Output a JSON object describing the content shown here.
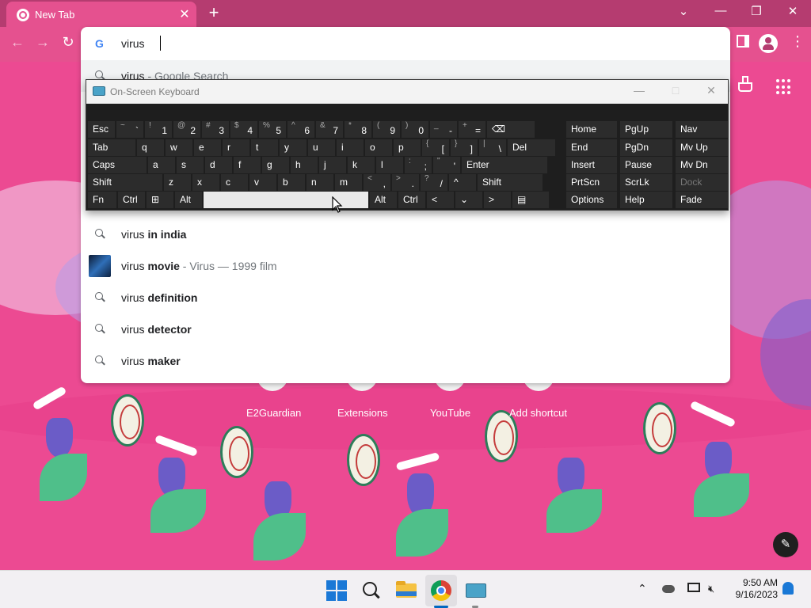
{
  "browser": {
    "tab_title": "New Tab",
    "tab_close": "✕",
    "new_tab": "+",
    "window_controls": {
      "dropdown": "⌄",
      "minimize": "—",
      "restore": "❐",
      "close": "✕"
    },
    "toolbar": {
      "back": "←",
      "forward": "→",
      "reload": "↻",
      "menu": "⋮"
    }
  },
  "omnibox": {
    "query": "virus",
    "suggestions": [
      {
        "prefix": "virus",
        "bold": "",
        "sub": " - Google Search",
        "icon": "search-icon"
      },
      {
        "prefix": "virus ",
        "bold": "in india",
        "sub": "",
        "icon": "search-icon"
      },
      {
        "prefix": "virus ",
        "bold": "movie",
        "sub": " - Virus — 1999 film",
        "icon": "movie-thumbnail"
      },
      {
        "prefix": "virus ",
        "bold": "definition",
        "sub": "",
        "icon": "search-icon"
      },
      {
        "prefix": "virus ",
        "bold": "detector",
        "sub": "",
        "icon": "search-icon"
      },
      {
        "prefix": "virus ",
        "bold": "maker",
        "sub": "",
        "icon": "search-icon"
      }
    ]
  },
  "osk": {
    "title": "On-Screen Keyboard",
    "controls": {
      "minimize": "—",
      "maximize": "□",
      "close": "✕"
    },
    "rows": [
      [
        {
          "main": "Esc"
        },
        {
          "sub": "~",
          "num": "`"
        },
        {
          "sub": "!",
          "num": "1"
        },
        {
          "sub": "@",
          "num": "2"
        },
        {
          "sub": "#",
          "num": "3"
        },
        {
          "sub": "$",
          "num": "4"
        },
        {
          "sub": "%",
          "num": "5"
        },
        {
          "sub": "^",
          "num": "6"
        },
        {
          "sub": "&",
          "num": "7"
        },
        {
          "sub": "*",
          "num": "8"
        },
        {
          "sub": "(",
          "num": "9"
        },
        {
          "sub": ")",
          "num": "0"
        },
        {
          "sub": "_",
          "num": "-"
        },
        {
          "sub": "+",
          "num": "="
        },
        {
          "main": "⌫"
        }
      ],
      [
        {
          "main": "Tab"
        },
        {
          "main": "q"
        },
        {
          "main": "w"
        },
        {
          "main": "e"
        },
        {
          "main": "r"
        },
        {
          "main": "t"
        },
        {
          "main": "y"
        },
        {
          "main": "u"
        },
        {
          "main": "i"
        },
        {
          "main": "o"
        },
        {
          "main": "p"
        },
        {
          "sub": "{",
          "num": "["
        },
        {
          "sub": "}",
          "num": "]"
        },
        {
          "sub": "|",
          "num": "\\"
        },
        {
          "main": "Del"
        }
      ],
      [
        {
          "main": "Caps"
        },
        {
          "main": "a"
        },
        {
          "main": "s"
        },
        {
          "main": "d"
        },
        {
          "main": "f"
        },
        {
          "main": "g"
        },
        {
          "main": "h"
        },
        {
          "main": "j"
        },
        {
          "main": "k"
        },
        {
          "main": "l"
        },
        {
          "sub": ":",
          "num": ";"
        },
        {
          "sub": "\"",
          "num": "'"
        },
        {
          "main": "Enter"
        }
      ],
      [
        {
          "main": "Shift"
        },
        {
          "main": "z"
        },
        {
          "main": "x"
        },
        {
          "main": "c"
        },
        {
          "main": "v"
        },
        {
          "main": "b"
        },
        {
          "main": "n"
        },
        {
          "main": "m"
        },
        {
          "sub": "<",
          "num": ","
        },
        {
          "sub": ">",
          "num": "."
        },
        {
          "sub": "?",
          "num": "/"
        },
        {
          "main": "^"
        },
        {
          "main": "Shift"
        }
      ],
      [
        {
          "main": "Fn"
        },
        {
          "main": "Ctrl"
        },
        {
          "main": "⊞"
        },
        {
          "main": "Alt"
        },
        {
          "main": ""
        },
        {
          "main": "Alt"
        },
        {
          "main": "Ctrl"
        },
        {
          "main": "<"
        },
        {
          "main": "⌄"
        },
        {
          "main": ">"
        },
        {
          "main": "▤"
        }
      ]
    ],
    "nav_keys": [
      [
        "Home",
        "PgUp",
        "Nav"
      ],
      [
        "End",
        "PgDn",
        "Mv Up"
      ],
      [
        "Insert",
        "Pause",
        "Mv Dn"
      ],
      [
        "PrtScn",
        "ScrLk",
        "Dock"
      ],
      [
        "Options",
        "Help",
        "Fade"
      ]
    ]
  },
  "shortcuts": [
    "E2Guardian",
    "Extensions",
    "YouTube",
    "Add shortcut"
  ],
  "taskbar": {
    "time": "9:50 AM",
    "date": "9/16/2023",
    "tray_chevron": "⌃"
  },
  "colors": {
    "wallpaper": "#ec4a92",
    "tab_strip": "#b53c70",
    "toolbar": "#e5518f",
    "osk_background": "#1e1e1e",
    "osk_key": "#2c2c2c"
  }
}
